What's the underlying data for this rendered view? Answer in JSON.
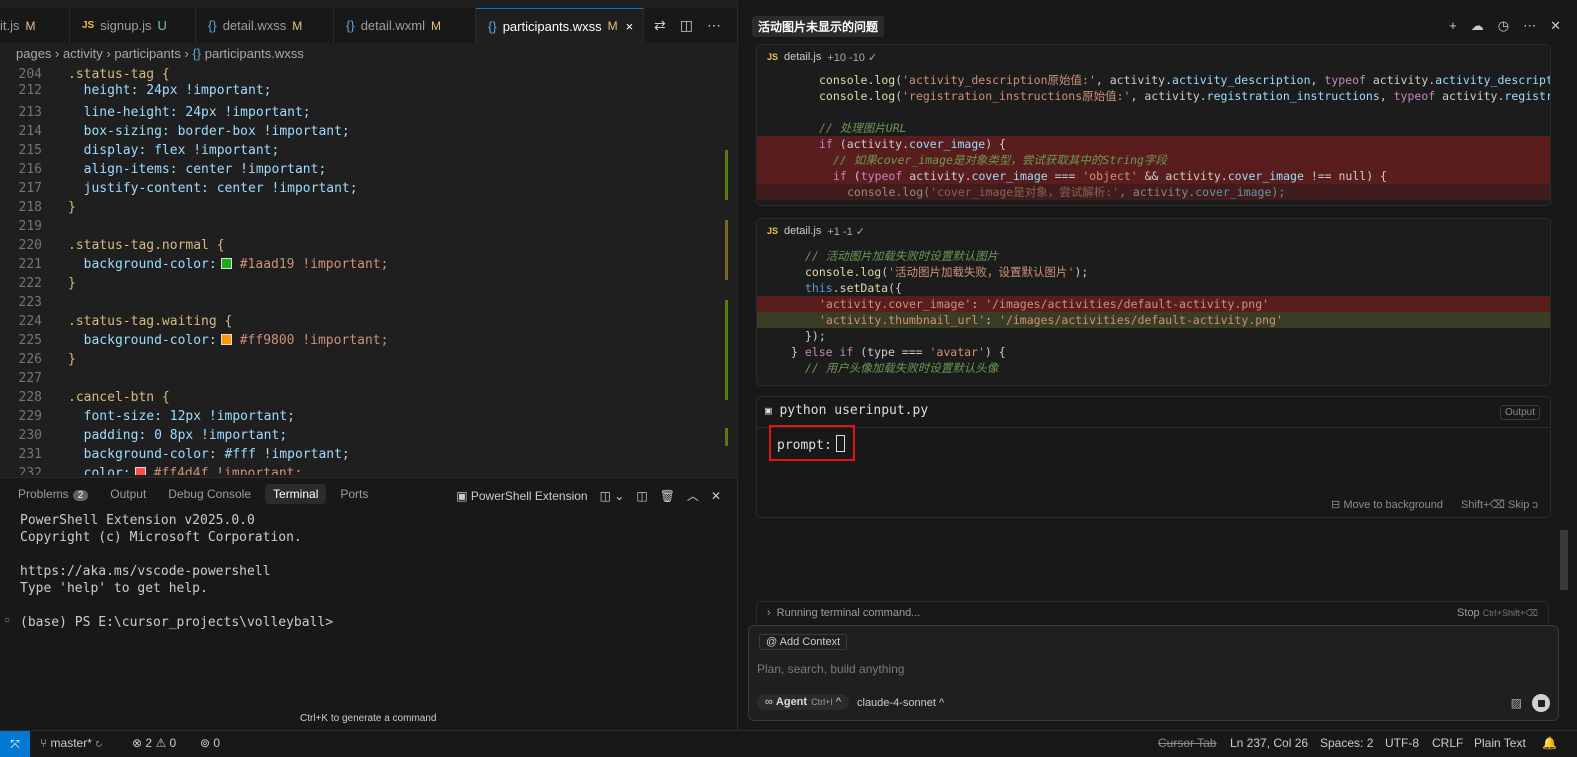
{
  "tabs": [
    {
      "icon": "",
      "label": "it.js",
      "status": "M"
    },
    {
      "icon": "JS",
      "label": "signup.js",
      "status": "U"
    },
    {
      "icon": "{}",
      "label": "detail.wxss",
      "status": "M"
    },
    {
      "icon": "{}",
      "label": "detail.wxml",
      "status": "M"
    },
    {
      "icon": "{}",
      "label": "participants.wxss",
      "status": "M",
      "close": "×"
    }
  ],
  "breadcrumb": {
    "p1": "pages",
    "p2": "activity",
    "p3": "participants",
    "p4": "participants.wxss",
    "sep": "›"
  },
  "code": [
    {
      "n": "204",
      "t": ".status-tag {"
    },
    {
      "n": "212",
      "t": "  height: 24px !important;"
    },
    {
      "n": "213",
      "t": "  line-height: 24px !important;"
    },
    {
      "n": "214",
      "t": "  box-sizing: border-box !important;"
    },
    {
      "n": "215",
      "t": "  display: flex !important;"
    },
    {
      "n": "216",
      "t": "  align-items: center !important;"
    },
    {
      "n": "217",
      "t": "  justify-content: center !important;"
    },
    {
      "n": "218",
      "t": "}"
    },
    {
      "n": "219",
      "t": ""
    },
    {
      "n": "220",
      "t": ".status-tag.normal {"
    },
    {
      "n": "221",
      "t": "  background-color:",
      "sw": "#1aad19",
      "tail": "#1aad19 !important;"
    },
    {
      "n": "222",
      "t": "}"
    },
    {
      "n": "223",
      "t": ""
    },
    {
      "n": "224",
      "t": ".status-tag.waiting {"
    },
    {
      "n": "225",
      "t": "  background-color:",
      "sw": "#ff9800",
      "tail": "#ff9800 !important;"
    },
    {
      "n": "226",
      "t": "}"
    },
    {
      "n": "227",
      "t": ""
    },
    {
      "n": "228",
      "t": ".cancel-btn {"
    },
    {
      "n": "229",
      "t": "  font-size: 12px !important;"
    },
    {
      "n": "230",
      "t": "  padding: 0 8px !important;"
    },
    {
      "n": "231",
      "t": "  background-color: #fff !important;"
    },
    {
      "n": "232",
      "t": "  color:",
      "sw": "#ff4d4f",
      "tail": "#ff4d4f !important;"
    }
  ],
  "panel": {
    "tabs": [
      {
        "label": "Problems",
        "badge": "2"
      },
      {
        "label": "Output"
      },
      {
        "label": "Debug Console"
      },
      {
        "label": "Terminal",
        "active": true
      },
      {
        "label": "Ports"
      }
    ],
    "shell": "PowerShell Extension",
    "terminal_lines": [
      "PowerShell Extension v2025.0.0",
      "Copyright (c) Microsoft Corporation.",
      "",
      "https://aka.ms/vscode-powershell",
      "Type 'help' to get help.",
      "",
      "(base) PS E:\\cursor_projects\\volleyball>"
    ],
    "hint": "Ctrl+K to generate a command"
  },
  "chat": {
    "title": "活动图片未显示的问题",
    "diff1": {
      "file": "detail.js",
      "stats": "+10 -10 ✓"
    },
    "diff2": {
      "file": "detail.js",
      "stats": "+1 -1 ✓"
    },
    "term_header": "python userinput.py",
    "output_label": "Output",
    "prompt": "prompt:",
    "move_bg": "Move to background",
    "skip": "Shift+⌫ Skip",
    "running": "Running terminal command...",
    "stop": "Stop",
    "stop_key": "Ctrl+Shift+⌫",
    "add_context": "@ Add Context",
    "placeholder": "Plan, search, build anything",
    "agent": "Agent",
    "agent_key": "Ctrl+I",
    "model": "claude-4-sonnet"
  },
  "status": {
    "branch": "master*",
    "errors": "2",
    "warnings": "0",
    "ports": "0",
    "cursor_tab": "Cursor Tab",
    "position": "Ln 237, Col 26",
    "spaces": "Spaces: 2",
    "encoding": "UTF-8",
    "eol": "CRLF",
    "lang": "Plain Text"
  }
}
